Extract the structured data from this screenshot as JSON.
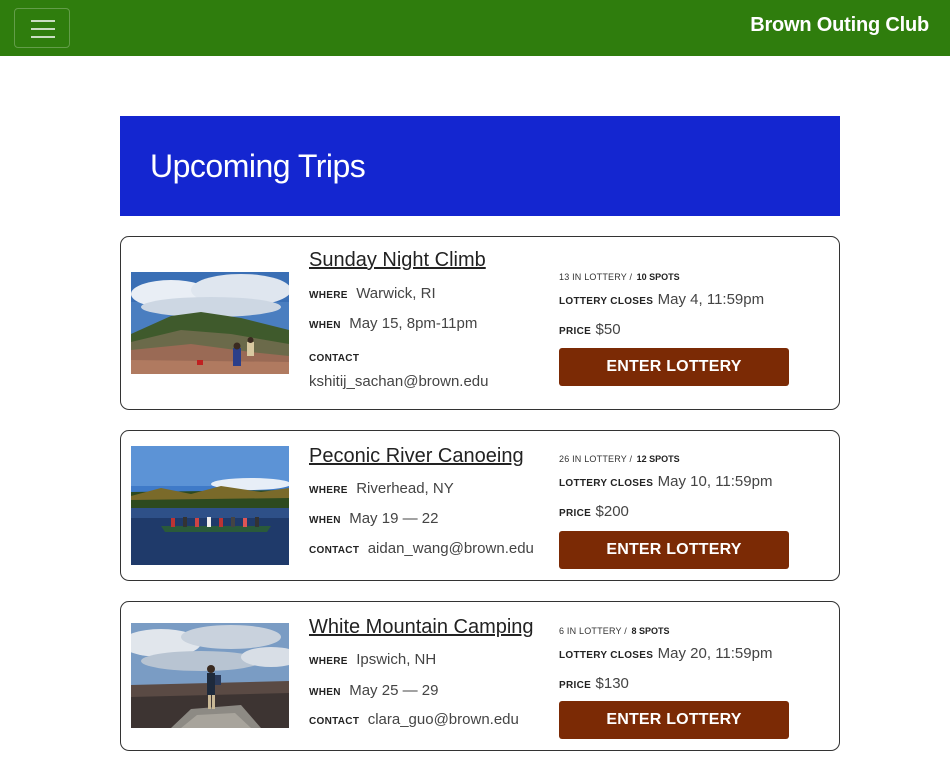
{
  "nav": {
    "brand": "Brown Outing Club",
    "menu_icon": "hamburger-menu-icon"
  },
  "hero": {
    "title": "Upcoming Trips"
  },
  "labels": {
    "where": "WHERE",
    "when": "WHEN",
    "contact": "CONTACT",
    "lottery_closes": "LOTTERY CLOSES",
    "price": "PRICE",
    "in_lottery_suffix": " IN LOTTERY / "
  },
  "trips": [
    {
      "title": "Sunday Night Climb",
      "where": "Warwick, RI",
      "when": "May 15, 8pm-11pm",
      "contact": "kshitij_sachan@brown.edu",
      "lottery_count": "13 IN LOTTERY /",
      "spots": "10 SPOTS",
      "lottery_closes": "May 4, 11:59pm",
      "price": "$50",
      "button": "ENTER LOTTERY"
    },
    {
      "title": "Peconic River Canoeing",
      "where": "Riverhead, NY",
      "when": "May 19 — 22",
      "contact": "aidan_wang@brown.edu",
      "lottery_count": "26 IN LOTTERY /",
      "spots": "12 SPOTS",
      "lottery_closes": "May 10, 11:59pm",
      "price": "$200",
      "button": "ENTER LOTTERY"
    },
    {
      "title": "White Mountain Camping",
      "where": "Ipswich, NH",
      "when": "May 25 — 29",
      "contact": "clara_guo@brown.edu",
      "lottery_count": "6 IN LOTTERY /",
      "spots": "8 SPOTS",
      "lottery_closes": "May 20, 11:59pm",
      "price": "$130",
      "button": "ENTER LOTTERY"
    }
  ],
  "colors": {
    "navbar": "#2f7d0d",
    "hero": "#1426d0",
    "button": "#7b2a05"
  }
}
